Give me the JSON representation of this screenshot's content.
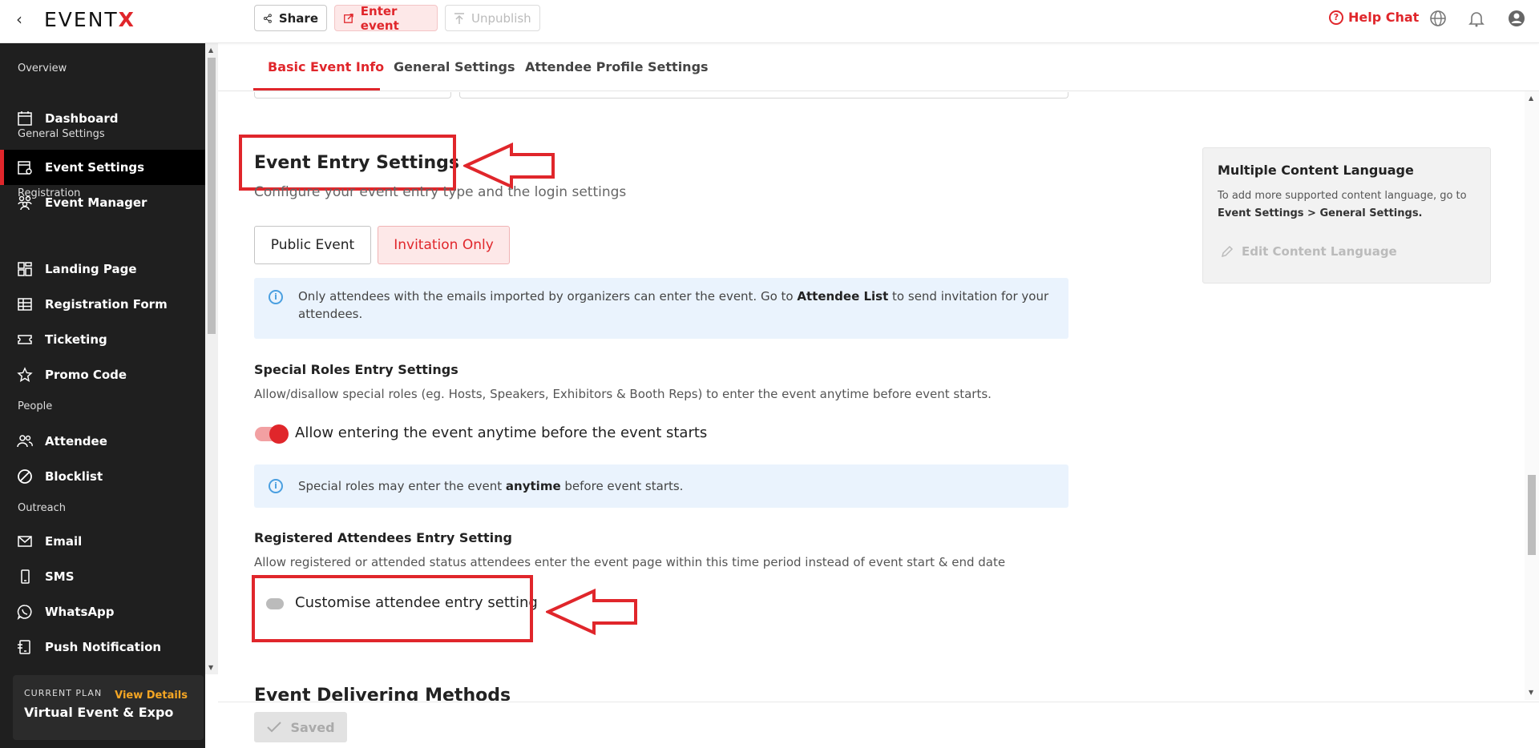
{
  "topbar": {
    "logo_main": "EVENT",
    "logo_x": "X",
    "back_icon": "‹",
    "share_label": "Share",
    "enter_label": "Enter event",
    "unpublish_label": "Unpublish",
    "help_label": "Help Chat",
    "help_icon": "?"
  },
  "sidebar": {
    "sections": {
      "overview": "Overview",
      "general": "General Settings",
      "registration": "Registration",
      "people": "People",
      "outreach": "Outreach"
    },
    "items": [
      {
        "label": "Dashboard"
      },
      {
        "label": "Event Settings"
      },
      {
        "label": "Event Manager"
      },
      {
        "label": "Landing Page"
      },
      {
        "label": "Registration Form"
      },
      {
        "label": "Ticketing"
      },
      {
        "label": "Promo Code"
      },
      {
        "label": "Attendee"
      },
      {
        "label": "Blocklist"
      },
      {
        "label": "Email"
      },
      {
        "label": "SMS"
      },
      {
        "label": "WhatsApp"
      },
      {
        "label": "Push Notification"
      }
    ],
    "plan": {
      "label": "CURRENT PLAN",
      "link": "View Details",
      "name": "Virtual Event & Expo"
    }
  },
  "tabs": [
    {
      "label": "Basic Event Info"
    },
    {
      "label": "General Settings"
    },
    {
      "label": "Attendee Profile Settings"
    }
  ],
  "entry": {
    "title": "Event Entry Settings",
    "subtitle": "Configure your event entry type and the login settings",
    "public_label": "Public Event",
    "invite_label": "Invitation Only",
    "info_pre": "Only attendees with the emails imported by organizers can enter the event. Go to ",
    "info_link": "Attendee List",
    "info_post": " to send invitation for your attendees.",
    "info_icon": "i"
  },
  "special": {
    "title": "Special Roles Entry Settings",
    "desc": "Allow/disallow special roles (eg. Hosts, Speakers, Exhibitors & Booth Reps) to enter the event anytime before event starts.",
    "toggle_label": "Allow entering the event anytime before the event starts",
    "toggle_on": true,
    "info_pre": "Special roles may enter the event ",
    "info_bold": "anytime",
    "info_post": " before event starts."
  },
  "registered": {
    "title": "Registered Attendees Entry Setting",
    "desc": "Allow registered or attended status attendees enter the event page within this time period instead of event start & end date",
    "toggle_label": "Customise attendee entry setting",
    "toggle_on": false
  },
  "delivering_title": "Event Delivering Methods",
  "side_card": {
    "title": "Multiple Content Language",
    "desc": "To add more supported content language, go to",
    "path": "Event Settings > General Settings.",
    "edit_label": "Edit Content Language"
  },
  "bottom": {
    "saved_label": "Saved"
  },
  "colors": {
    "accent": "#e0262b",
    "sidebar_bg": "#1f1f1f",
    "info_bg": "#eaf3fd"
  }
}
